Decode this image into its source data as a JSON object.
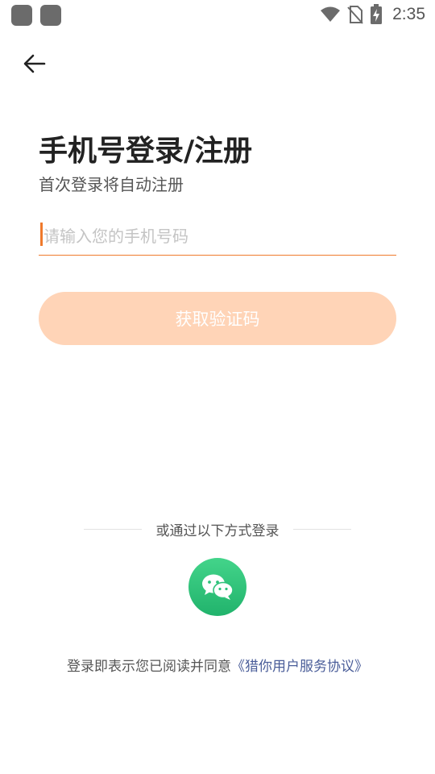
{
  "status_bar": {
    "time": "2:35",
    "icons": [
      "notification-icon",
      "notification-icon",
      "wifi-icon",
      "no-sim-icon",
      "battery-charging-icon"
    ]
  },
  "nav": {
    "back_icon": "arrow-left-icon"
  },
  "header": {
    "title": "手机号登录/注册",
    "subtitle": "首次登录将自动注册"
  },
  "form": {
    "phone_placeholder": "请输入您的手机号码",
    "phone_value": "",
    "get_code_label": "获取验证码"
  },
  "alt_login": {
    "divider_text": "或通过以下方式登录",
    "wechat_icon": "wechat-icon"
  },
  "agreement": {
    "prefix": "登录即表示您已阅读并同意",
    "link_text": "《猎你用户服务协议》"
  },
  "colors": {
    "accent": "#ef7a2c",
    "button_disabled": "#ffd4b7",
    "wechat_green": "#2ec27a",
    "link": "#4a5d99"
  }
}
